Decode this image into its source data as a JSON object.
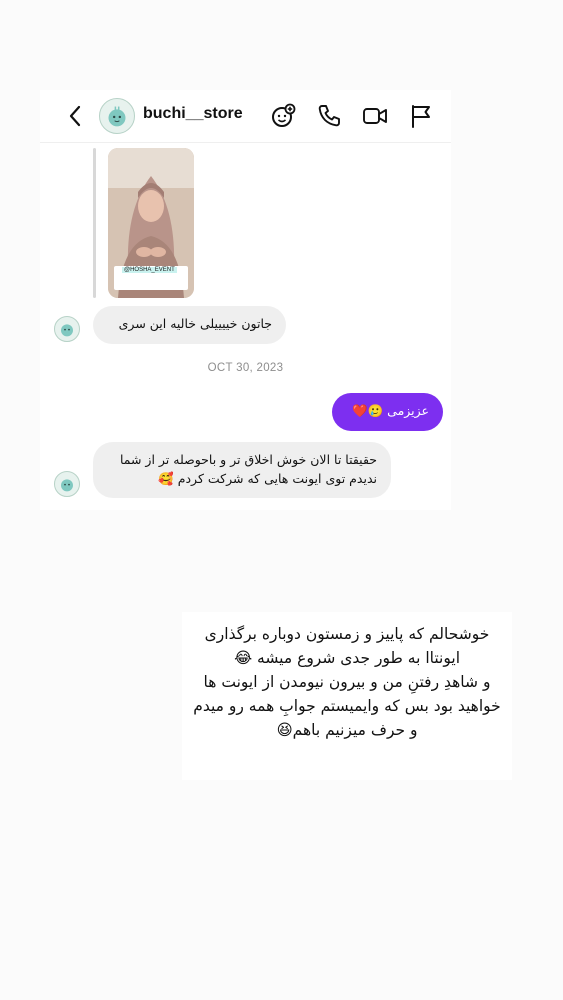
{
  "header": {
    "username": "buchi__store",
    "icons": [
      "back-arrow-icon",
      "add-emoji-icon",
      "phone-icon",
      "video-icon",
      "flag-icon"
    ]
  },
  "shared_post": {
    "badge": "@HOSHA_EVENT"
  },
  "messages": [
    {
      "direction": "in",
      "text": "جاتون خییییلی خالیه این سری"
    },
    {
      "direction": "out",
      "text": "عزیزمی 🥲❤️"
    },
    {
      "direction": "in",
      "text": "حقیقتا تا الان خوش اخلاق تر و باحوصله تر از شما ندیدم توی ایونت هایی که شرکت کردم 🥰"
    }
  ],
  "date_separator": "OCT 30, 2023",
  "caption": {
    "line1": "خوشحالم که پاییز و زمستون دوباره برگذاری ایونتاا به طور جدی شروع میشه 😂",
    "line2": "و شاهدِ رفتنِ من و بیرون نیومدن از ایونت ها خواهید بود بس که وایمیستم جوابِ همه رو میدم و حرف میزنیم باهم😆"
  },
  "colors": {
    "outgoing_bubble": "#7d2ff0",
    "incoming_bubble": "#efefef",
    "avatar_bg": "#e7f2ee"
  }
}
